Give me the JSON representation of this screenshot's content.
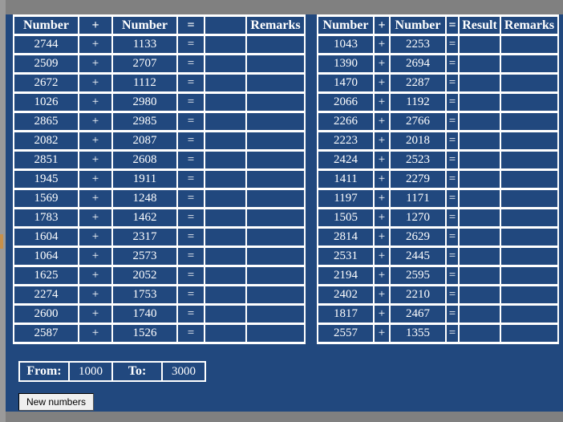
{
  "app": {
    "background_color": "#21487e",
    "page_surround_color": "#808080",
    "text_color": "#ffffff",
    "grid_color": "#ffffff"
  },
  "left_table": {
    "name": "addition-practice-table-left",
    "headers": [
      "Number",
      "+",
      "Number",
      "=",
      "",
      "Remarks"
    ],
    "rows": [
      {
        "a": "2744",
        "op": "+",
        "b": "1133",
        "eq": "=",
        "result": "",
        "remarks": ""
      },
      {
        "a": "2509",
        "op": "+",
        "b": "2707",
        "eq": "=",
        "result": "",
        "remarks": ""
      },
      {
        "a": "2672",
        "op": "+",
        "b": "1112",
        "eq": "=",
        "result": "",
        "remarks": ""
      },
      {
        "a": "1026",
        "op": "+",
        "b": "2980",
        "eq": "=",
        "result": "",
        "remarks": ""
      },
      {
        "a": "2865",
        "op": "+",
        "b": "2985",
        "eq": "=",
        "result": "",
        "remarks": ""
      },
      {
        "a": "2082",
        "op": "+",
        "b": "2087",
        "eq": "=",
        "result": "",
        "remarks": ""
      },
      {
        "a": "2851",
        "op": "+",
        "b": "2608",
        "eq": "=",
        "result": "",
        "remarks": ""
      },
      {
        "a": "1945",
        "op": "+",
        "b": "1911",
        "eq": "=",
        "result": "",
        "remarks": ""
      },
      {
        "a": "1569",
        "op": "+",
        "b": "1248",
        "eq": "=",
        "result": "",
        "remarks": ""
      },
      {
        "a": "1783",
        "op": "+",
        "b": "1462",
        "eq": "=",
        "result": "",
        "remarks": ""
      },
      {
        "a": "1604",
        "op": "+",
        "b": "2317",
        "eq": "=",
        "result": "",
        "remarks": ""
      },
      {
        "a": "1064",
        "op": "+",
        "b": "2573",
        "eq": "=",
        "result": "",
        "remarks": ""
      },
      {
        "a": "1625",
        "op": "+",
        "b": "2052",
        "eq": "=",
        "result": "",
        "remarks": ""
      },
      {
        "a": "2274",
        "op": "+",
        "b": "1753",
        "eq": "=",
        "result": "",
        "remarks": ""
      },
      {
        "a": "2600",
        "op": "+",
        "b": "1740",
        "eq": "=",
        "result": "",
        "remarks": ""
      },
      {
        "a": "2587",
        "op": "+",
        "b": "1526",
        "eq": "=",
        "result": "",
        "remarks": ""
      }
    ]
  },
  "right_table": {
    "name": "addition-practice-table-right",
    "headers": [
      "Number",
      "+",
      "Number",
      "=",
      "Result",
      "Remarks"
    ],
    "rows": [
      {
        "a": "1043",
        "op": "+",
        "b": "2253",
        "eq": "=",
        "result": "",
        "remarks": ""
      },
      {
        "a": "1390",
        "op": "+",
        "b": "2694",
        "eq": "=",
        "result": "",
        "remarks": ""
      },
      {
        "a": "1470",
        "op": "+",
        "b": "2287",
        "eq": "=",
        "result": "",
        "remarks": ""
      },
      {
        "a": "2066",
        "op": "+",
        "b": "1192",
        "eq": "=",
        "result": "",
        "remarks": ""
      },
      {
        "a": "2266",
        "op": "+",
        "b": "2766",
        "eq": "=",
        "result": "",
        "remarks": ""
      },
      {
        "a": "2223",
        "op": "+",
        "b": "2018",
        "eq": "=",
        "result": "",
        "remarks": ""
      },
      {
        "a": "2424",
        "op": "+",
        "b": "2523",
        "eq": "=",
        "result": "",
        "remarks": ""
      },
      {
        "a": "1411",
        "op": "+",
        "b": "2279",
        "eq": "=",
        "result": "",
        "remarks": ""
      },
      {
        "a": "1197",
        "op": "+",
        "b": "1171",
        "eq": "=",
        "result": "",
        "remarks": ""
      },
      {
        "a": "1505",
        "op": "+",
        "b": "1270",
        "eq": "=",
        "result": "",
        "remarks": ""
      },
      {
        "a": "2814",
        "op": "+",
        "b": "2629",
        "eq": "=",
        "result": "",
        "remarks": ""
      },
      {
        "a": "2531",
        "op": "+",
        "b": "2445",
        "eq": "=",
        "result": "",
        "remarks": ""
      },
      {
        "a": "2194",
        "op": "+",
        "b": "2595",
        "eq": "=",
        "result": "",
        "remarks": ""
      },
      {
        "a": "2402",
        "op": "+",
        "b": "2210",
        "eq": "=",
        "result": "",
        "remarks": ""
      },
      {
        "a": "1817",
        "op": "+",
        "b": "2467",
        "eq": "=",
        "result": "",
        "remarks": ""
      },
      {
        "a": "2557",
        "op": "+",
        "b": "1355",
        "eq": "=",
        "result": "",
        "remarks": ""
      }
    ]
  },
  "range": {
    "from_label": "From:",
    "from_value": "1000",
    "to_label": "To:",
    "to_value": "3000"
  },
  "actions": {
    "new_numbers_label": "New numbers"
  }
}
